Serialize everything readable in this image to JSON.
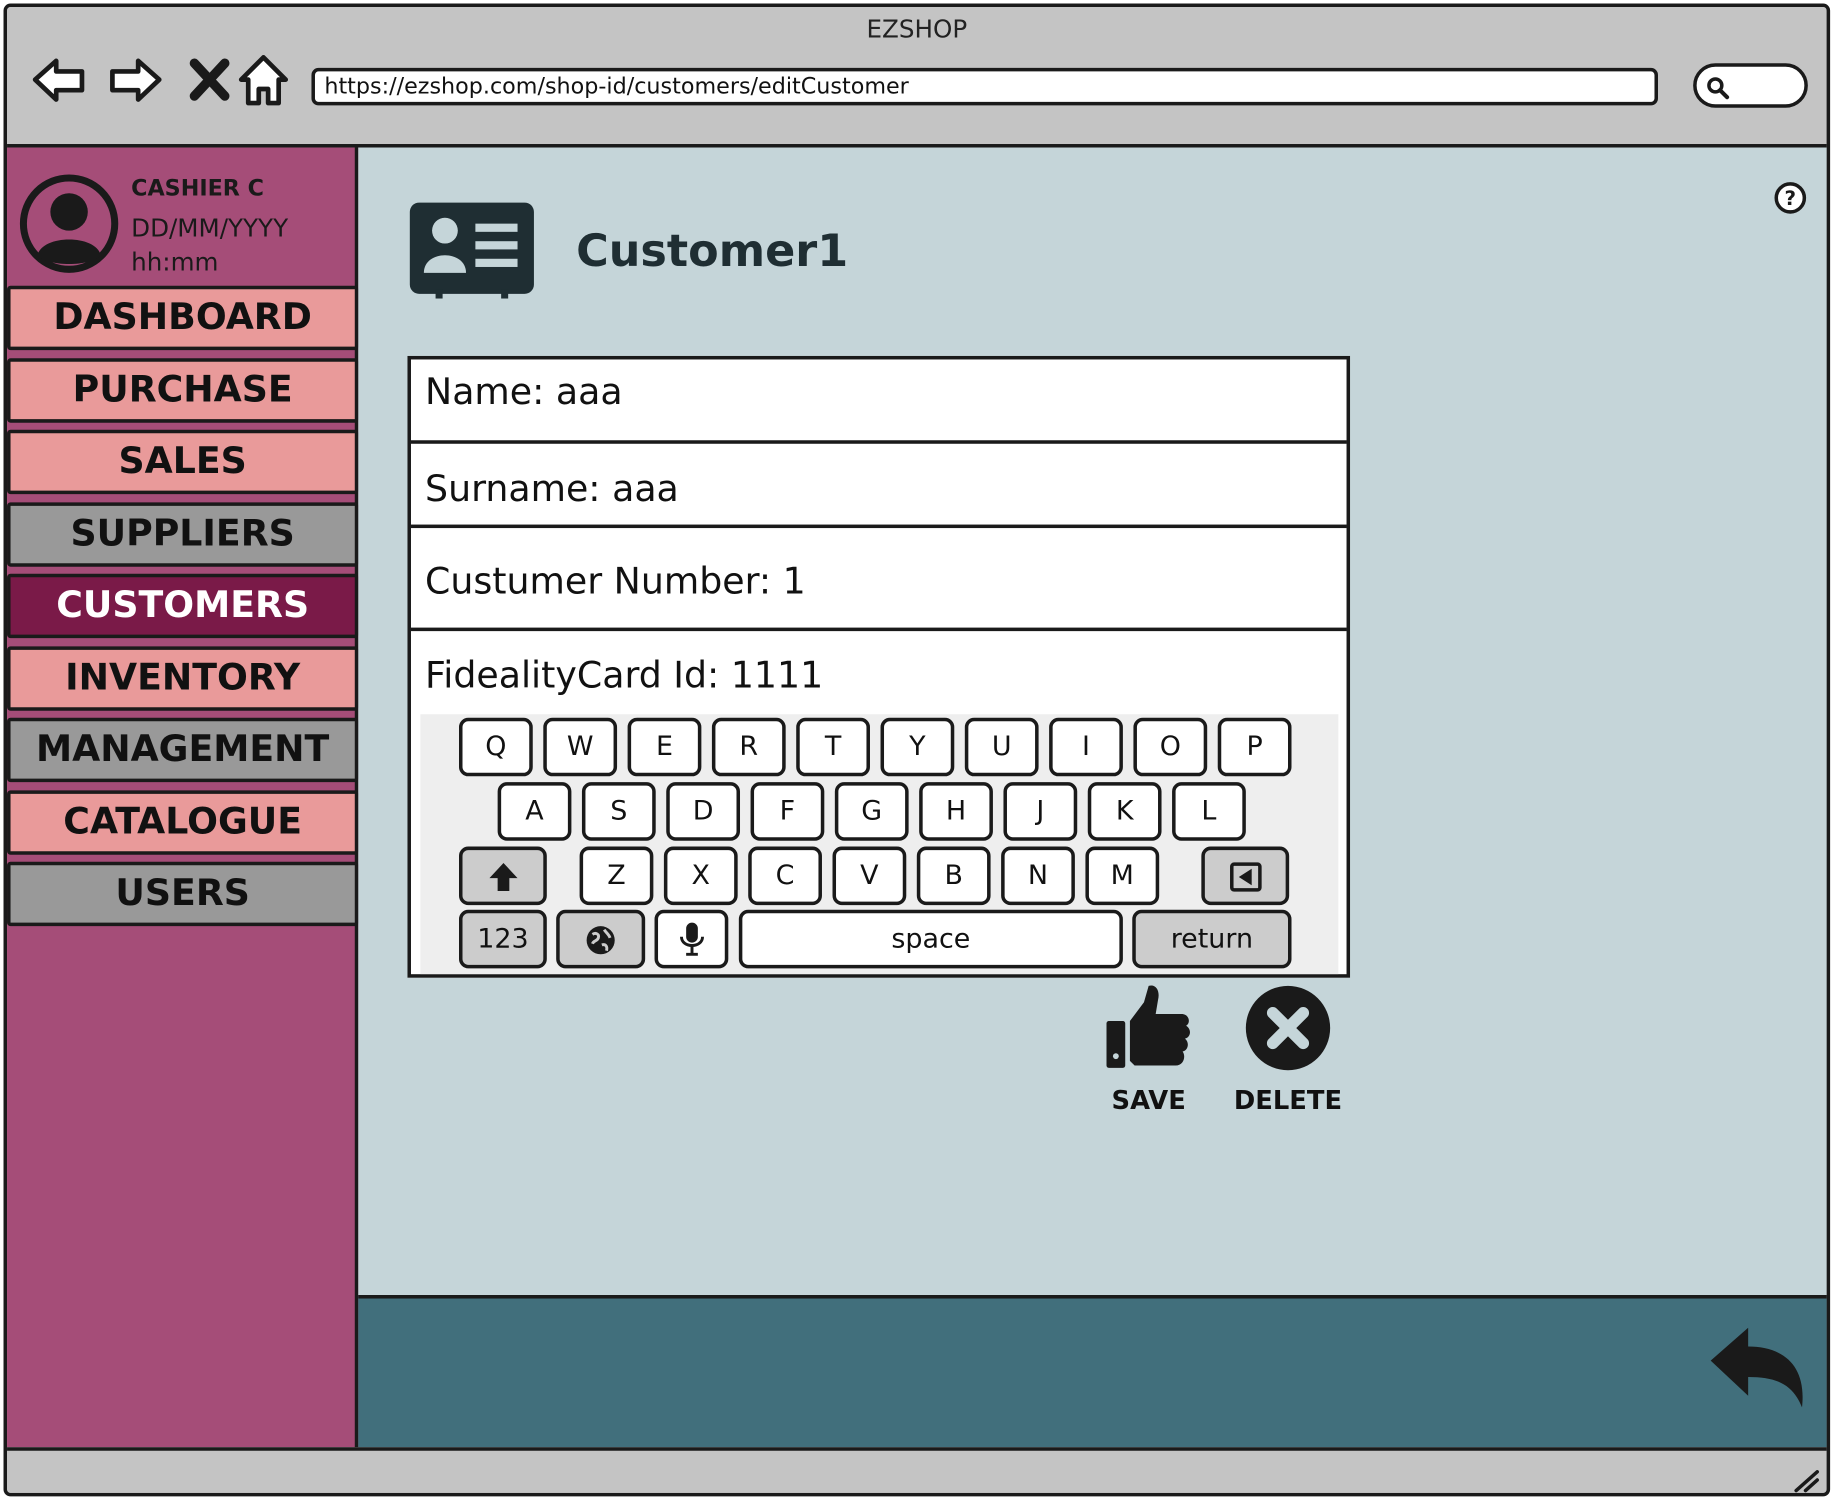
{
  "window": {
    "title": "EZSHOP",
    "url": "https://ezshop.com/shop-id/customers/editCustomer"
  },
  "browser_icons": [
    "back-icon",
    "forward-icon",
    "stop-icon",
    "home-icon",
    "search-icon"
  ],
  "user": {
    "name": "CASHIER C",
    "date": "DD/MM/YYYY",
    "time": "hh:mm"
  },
  "nav": [
    {
      "label": "DASHBOARD",
      "style": "pink"
    },
    {
      "label": "PURCHASE",
      "style": "pink"
    },
    {
      "label": "SALES",
      "style": "pink"
    },
    {
      "label": "SUPPLIERS",
      "style": "gray"
    },
    {
      "label": "CUSTOMERS",
      "style": "active"
    },
    {
      "label": "INVENTORY",
      "style": "pink"
    },
    {
      "label": "MANAGEMENT",
      "style": "gray"
    },
    {
      "label": "CATALOGUE",
      "style": "pink"
    },
    {
      "label": "USERS",
      "style": "gray"
    }
  ],
  "customer": {
    "title": "Customer1",
    "name": "Name: aaa",
    "surname": "Surname: aaa",
    "number": "Custumer Number: 1",
    "card": "FidealityCard Id: 1111"
  },
  "keyboard": {
    "row1": [
      "Q",
      "W",
      "E",
      "R",
      "T",
      "Y",
      "U",
      "I",
      "O",
      "P"
    ],
    "row2": [
      "A",
      "S",
      "D",
      "F",
      "G",
      "H",
      "J",
      "K",
      "L"
    ],
    "row3": [
      "Z",
      "X",
      "C",
      "V",
      "B",
      "N",
      "M"
    ],
    "numbers": "123",
    "space": "space",
    "return": "return"
  },
  "actions": {
    "save": "SAVE",
    "delete": "DELETE"
  },
  "colors": {
    "sidebar": "#a54d78",
    "nav_pink": "#e99a9a",
    "nav_gray": "#999999",
    "nav_active": "#7a1a48",
    "main_bg": "#c5d5d9",
    "footer": "#416f7c",
    "chrome": "#c4c4c4"
  }
}
